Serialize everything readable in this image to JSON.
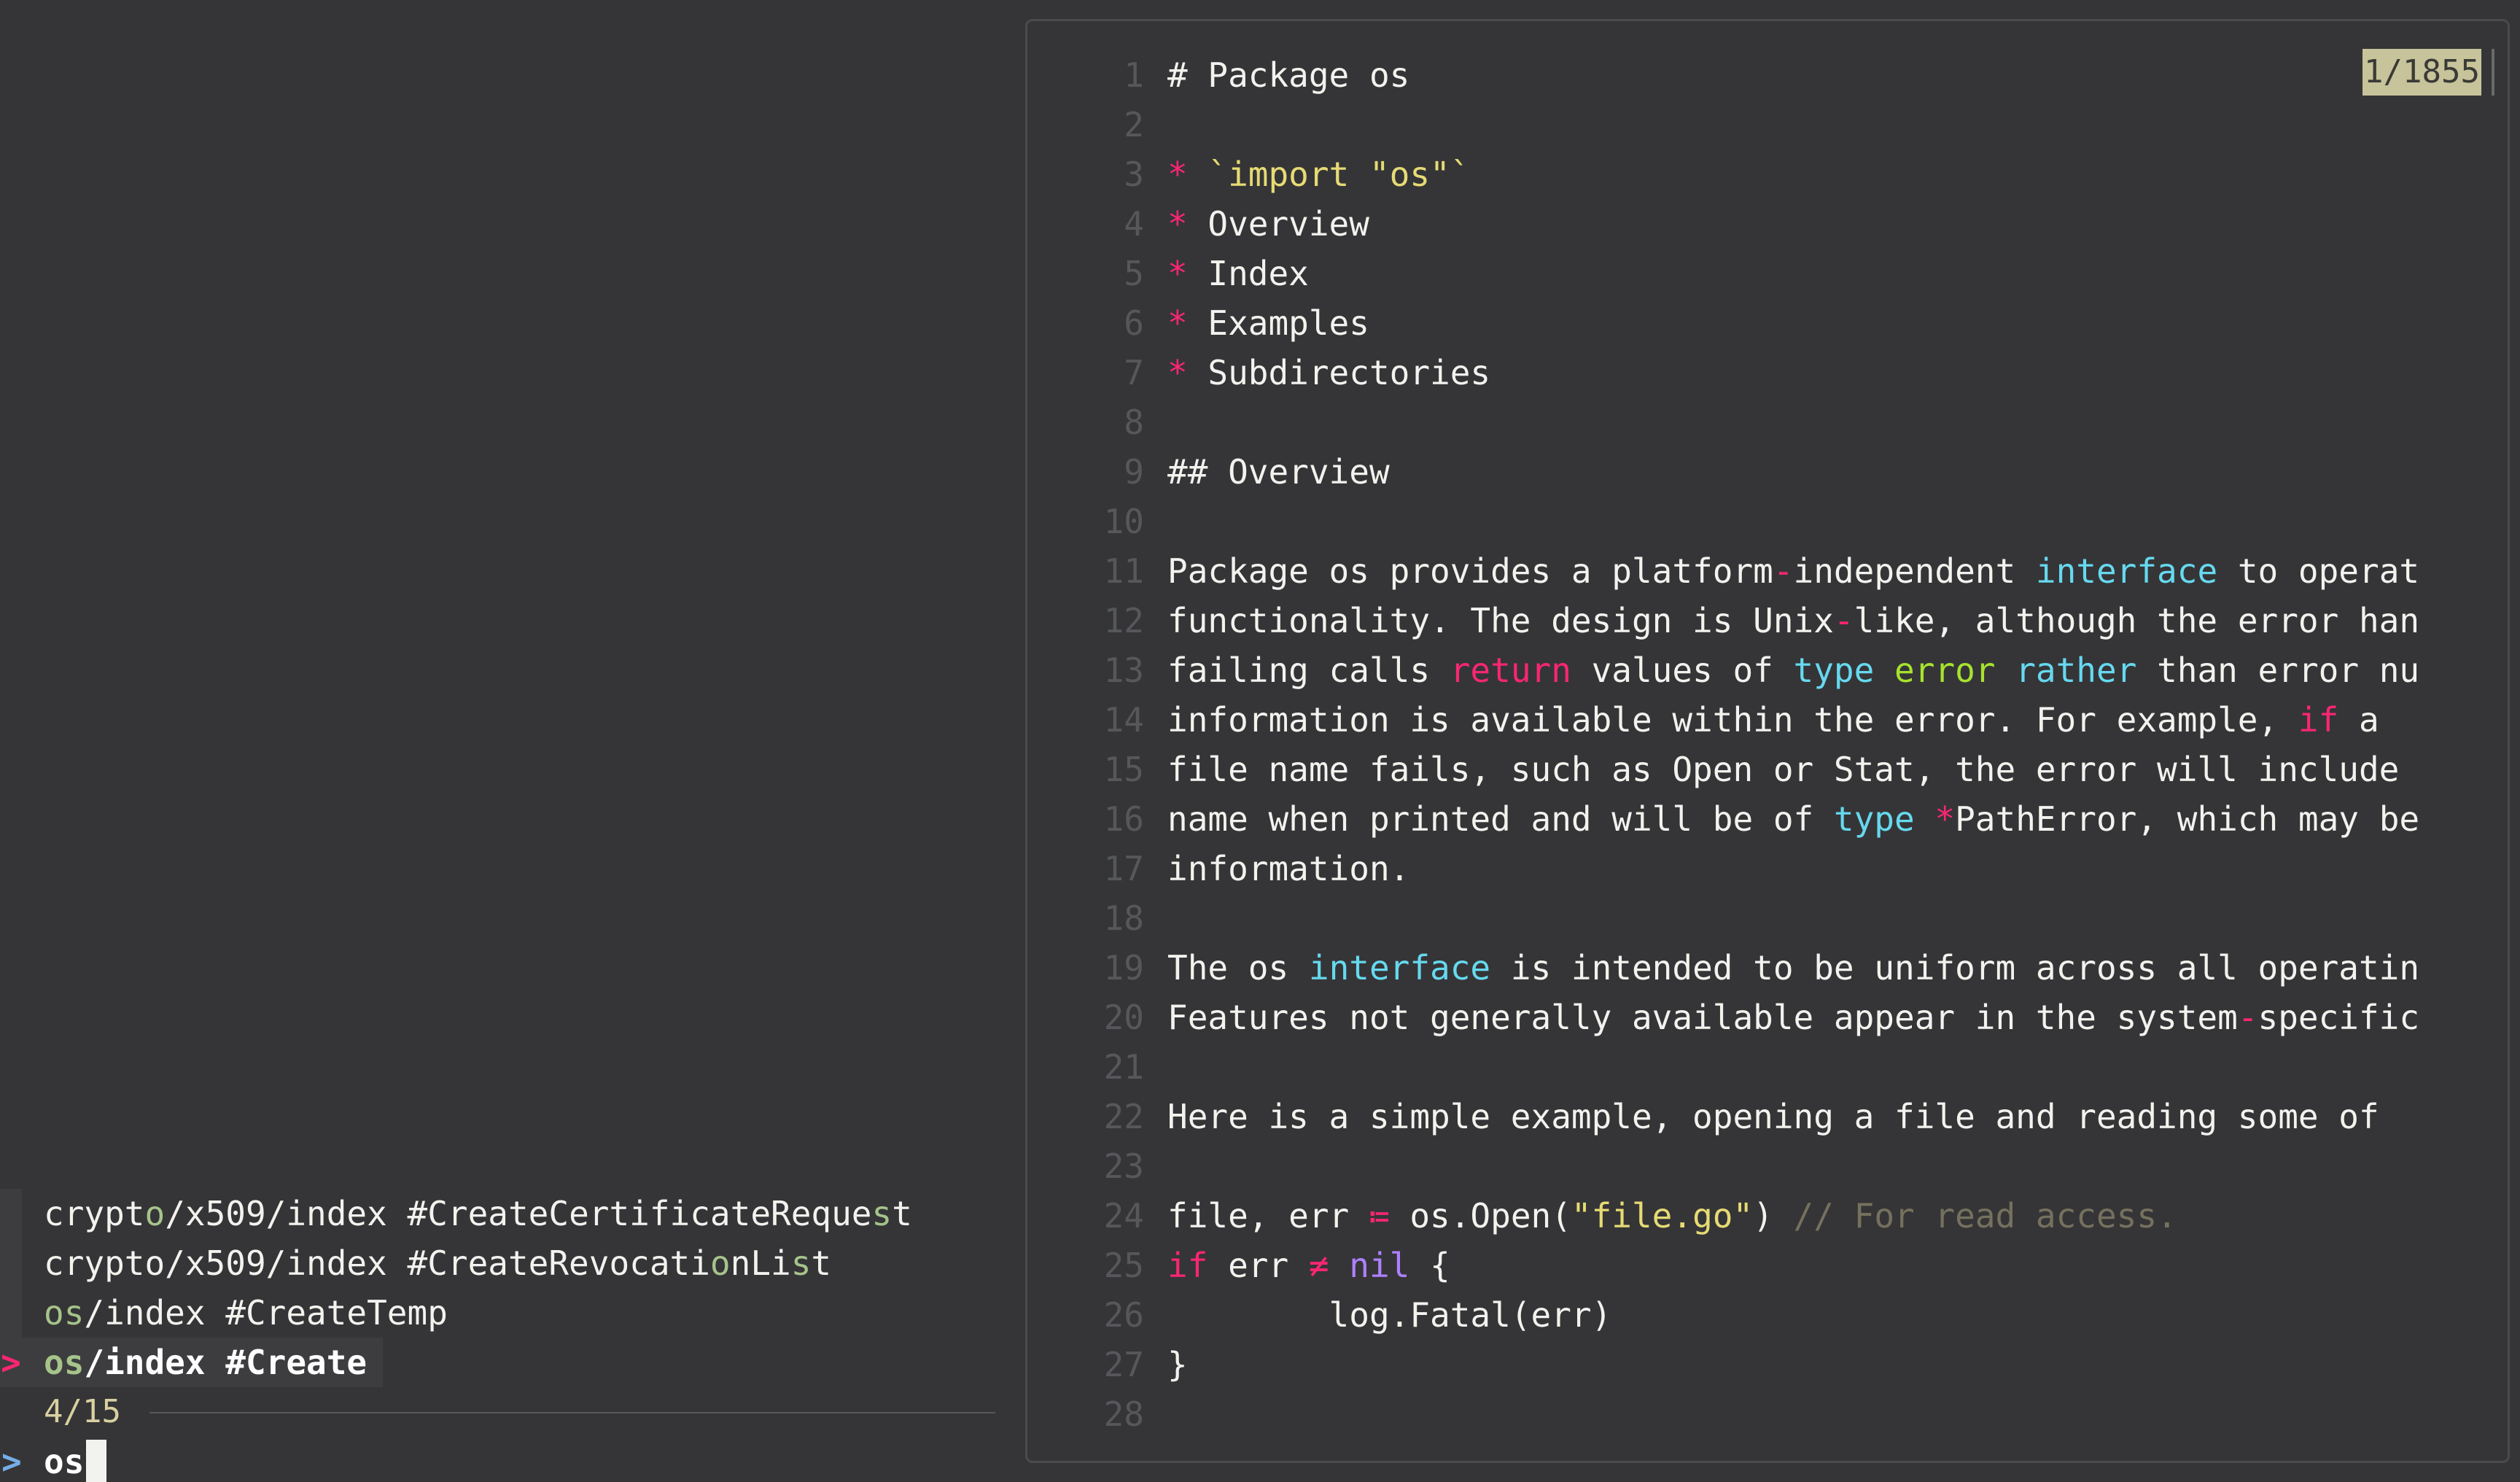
{
  "finder": {
    "results": [
      {
        "before": "crypt",
        "hl1": "o",
        "mid": "/x509/index #CreateCertificateReque",
        "hl2": "s",
        "after": "t"
      },
      {
        "before": "crypto/x509/index #CreateRevocati",
        "hl1": "o",
        "mid": "nLi",
        "hl2": "s",
        "after": "t"
      },
      {
        "before": "",
        "hl1": "os",
        "mid": "/index #CreateTemp",
        "hl2": "",
        "after": ""
      },
      {
        "before": "",
        "hl1": "os",
        "mid": "/index #Create",
        "hl2": "",
        "after": ""
      }
    ],
    "selected_index": 3,
    "pointer": ">",
    "count": "4/15",
    "prompt": ">",
    "query": "os"
  },
  "preview": {
    "scroll_position": "1/1855",
    "lines": [
      {
        "n": "1",
        "tokens": [
          {
            "t": "# Package os"
          }
        ]
      },
      {
        "n": "2",
        "tokens": []
      },
      {
        "n": "3",
        "tokens": [
          {
            "t": "* ",
            "c": "pink"
          },
          {
            "t": "`import \"os\"`",
            "c": "yellow"
          }
        ]
      },
      {
        "n": "4",
        "tokens": [
          {
            "t": "* ",
            "c": "pink"
          },
          {
            "t": "Overview"
          }
        ]
      },
      {
        "n": "5",
        "tokens": [
          {
            "t": "* ",
            "c": "pink"
          },
          {
            "t": "Index"
          }
        ]
      },
      {
        "n": "6",
        "tokens": [
          {
            "t": "* ",
            "c": "pink"
          },
          {
            "t": "Examples"
          }
        ]
      },
      {
        "n": "7",
        "tokens": [
          {
            "t": "* ",
            "c": "pink"
          },
          {
            "t": "Subdirectories"
          }
        ]
      },
      {
        "n": "8",
        "tokens": []
      },
      {
        "n": "9",
        "tokens": [
          {
            "t": "## Overview"
          }
        ]
      },
      {
        "n": "10",
        "tokens": []
      },
      {
        "n": "11",
        "tokens": [
          {
            "t": "Package os provides a platform"
          },
          {
            "t": "-",
            "c": "pink"
          },
          {
            "t": "independent "
          },
          {
            "t": "interface",
            "c": "cyan"
          },
          {
            "t": " to operat"
          }
        ]
      },
      {
        "n": "12",
        "tokens": [
          {
            "t": "functionality. The design is Unix"
          },
          {
            "t": "-",
            "c": "pink"
          },
          {
            "t": "like, although the error han"
          }
        ]
      },
      {
        "n": "13",
        "tokens": [
          {
            "t": "failing calls "
          },
          {
            "t": "return",
            "c": "pink"
          },
          {
            "t": " values of "
          },
          {
            "t": "type",
            "c": "cyan"
          },
          {
            "t": " "
          },
          {
            "t": "error",
            "c": "green"
          },
          {
            "t": " "
          },
          {
            "t": "rather",
            "c": "cyan"
          },
          {
            "t": " than error nu"
          }
        ]
      },
      {
        "n": "14",
        "tokens": [
          {
            "t": "information is available within the error. For example, "
          },
          {
            "t": "if",
            "c": "pink"
          },
          {
            "t": " a"
          }
        ]
      },
      {
        "n": "15",
        "tokens": [
          {
            "t": "file name fails, such as Open or Stat, the error will include"
          }
        ]
      },
      {
        "n": "16",
        "tokens": [
          {
            "t": "name when printed and will be of "
          },
          {
            "t": "type",
            "c": "cyan"
          },
          {
            "t": " "
          },
          {
            "t": "*",
            "c": "pink"
          },
          {
            "t": "PathError, which may be"
          }
        ]
      },
      {
        "n": "17",
        "tokens": [
          {
            "t": "information."
          }
        ]
      },
      {
        "n": "18",
        "tokens": []
      },
      {
        "n": "19",
        "tokens": [
          {
            "t": "The os "
          },
          {
            "t": "interface",
            "c": "cyan"
          },
          {
            "t": " is intended to be uniform across all operatin"
          }
        ]
      },
      {
        "n": "20",
        "tokens": [
          {
            "t": "Features not generally available appear in the system"
          },
          {
            "t": "-",
            "c": "pink"
          },
          {
            "t": "specific"
          }
        ]
      },
      {
        "n": "21",
        "tokens": []
      },
      {
        "n": "22",
        "tokens": [
          {
            "t": "Here is a simple example, opening a file and reading some of"
          }
        ]
      },
      {
        "n": "23",
        "tokens": []
      },
      {
        "n": "24",
        "tokens": [
          {
            "t": "file, err "
          },
          {
            "t": "≔",
            "c": "pink"
          },
          {
            "t": " os.Open("
          },
          {
            "t": "\"file.go\"",
            "c": "yellow"
          },
          {
            "t": ") "
          },
          {
            "t": "// For read access.",
            "c": "comment"
          }
        ]
      },
      {
        "n": "25",
        "tokens": [
          {
            "t": "if",
            "c": "pink"
          },
          {
            "t": " err "
          },
          {
            "t": "≠",
            "c": "pink"
          },
          {
            "t": " "
          },
          {
            "t": "nil",
            "c": "purple"
          },
          {
            "t": " {"
          }
        ]
      },
      {
        "n": "26",
        "tokens": [
          {
            "t": "        log.Fatal(err)"
          }
        ]
      },
      {
        "n": "27",
        "tokens": [
          {
            "t": "}"
          }
        ]
      },
      {
        "n": "28",
        "tokens": []
      }
    ]
  }
}
